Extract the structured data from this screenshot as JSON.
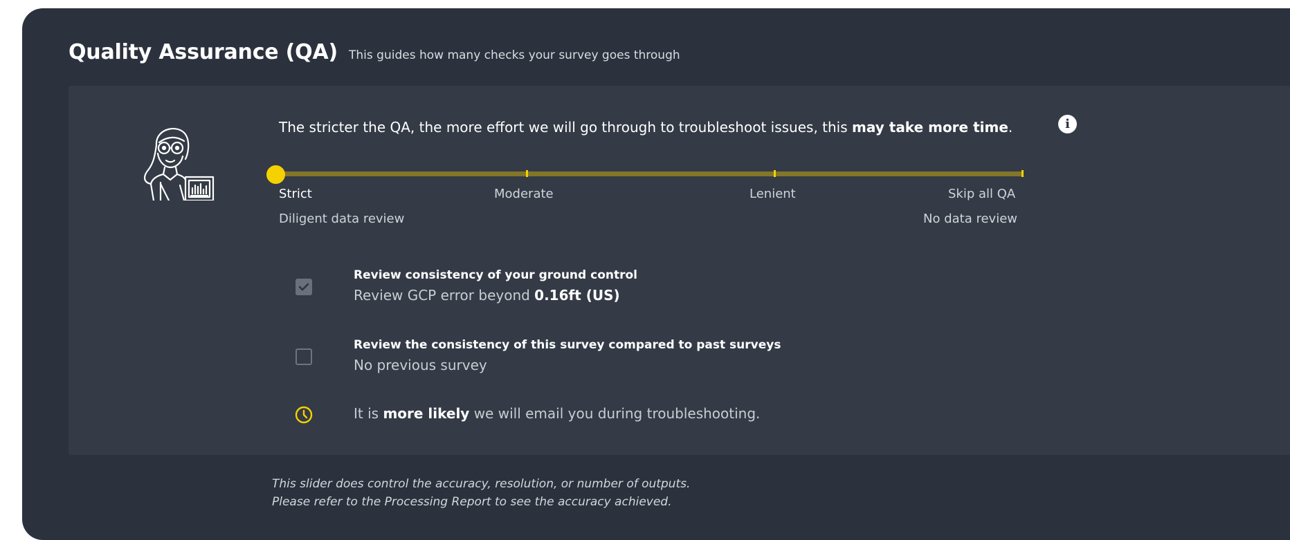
{
  "header": {
    "title": "Quality Assurance (QA)",
    "subtitle": "This guides how many checks your survey goes through"
  },
  "intro": {
    "text_before": "The stricter the QA, the more effort we will go through to troubleshoot issues, this ",
    "text_bold": "may take more time",
    "text_after": "."
  },
  "info_icon": "info-icon",
  "slider": {
    "selected": "Strict",
    "stops": [
      "Strict",
      "Moderate",
      "Lenient",
      "Skip all QA"
    ],
    "desc_left": "Diligent data review",
    "desc_right": "No data review",
    "accent_color": "#f6d100",
    "track_color": "#847629"
  },
  "options": [
    {
      "title": "Review consistency of your ground control",
      "desc_prefix": "Review GCP error beyond ",
      "desc_value": "0.16ft (US)",
      "checked": true
    },
    {
      "title": "Review the consistency of this survey compared to past surveys",
      "desc": "No previous survey",
      "checked": false
    }
  ],
  "notice": {
    "icon": "clock-icon",
    "text_before": "It is ",
    "text_bold": "more likely",
    "text_after": " we will email you during troubleshooting."
  },
  "footer": {
    "line1": "This slider does control the accuracy, resolution, or number of outputs.",
    "line2": "Please refer to the Processing Report to see the accuracy achieved."
  },
  "colors": {
    "panel": "#2b323d",
    "card": "#343b46"
  }
}
